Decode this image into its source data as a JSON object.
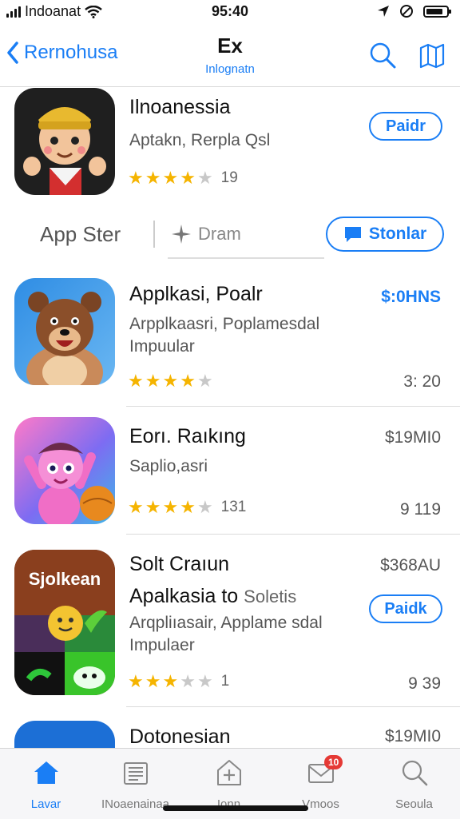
{
  "status_bar": {
    "carrier": "Indoanat",
    "time": "95:40"
  },
  "nav": {
    "back_label": "Rernohusa",
    "title": "Ex",
    "subtitle": "Inlognatn"
  },
  "featured": {
    "name": "Ilnoanessia",
    "subtitle": "Aptakn, Rerpla Qsl",
    "rating_count": "19",
    "button": "Paidr"
  },
  "segment": {
    "store_label": "App Ster",
    "drama_label": "Dram",
    "button_label": "Stonlar"
  },
  "apps": [
    {
      "name": "Applkasi, Poalr",
      "subtitle_1": "Arpplkaasri, Poplamesdal",
      "subtitle_2": "Impuular",
      "rating_count": "",
      "price": "$:0HNS",
      "meta": "3: 20"
    },
    {
      "name": "Eorı. Raıkıng",
      "subtitle_1": "Saplio,asri",
      "rating_count": "131",
      "price": "$19MI0",
      "meta": "9 119"
    },
    {
      "name": "Solt Craıun",
      "name_2a": "Apalkasia to",
      "name_2b": "Soletis",
      "subtitle_1": "Arqpliıasair, Applame sdal",
      "subtitle_2": "Impulaer",
      "rating_count": "1",
      "price": "$368AU",
      "button": "Paidk",
      "meta": "9 39",
      "icon_text": "Sjolkean"
    },
    {
      "name": "Dotonesian",
      "price": "$19MI0"
    }
  ],
  "tabs": [
    {
      "label": "Lavar"
    },
    {
      "label": "INoaenainaa"
    },
    {
      "label": "Ionn"
    },
    {
      "label": "Vmoos",
      "badge": "10"
    },
    {
      "label": "Seoula"
    }
  ],
  "colors": {
    "accent": "#1a7ef5",
    "star": "#f5b400",
    "badge": "#e53935"
  }
}
